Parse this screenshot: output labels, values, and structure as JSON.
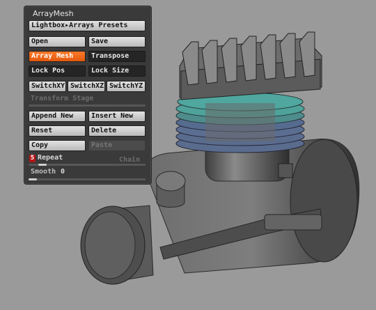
{
  "panel": {
    "title": "ArrayMesh",
    "lightbox_label": "Lightbox▸Arrays Presets",
    "open_label": "Open",
    "save_label": "Save",
    "array_mesh_label": "Array Mesh",
    "transpose_label": "Transpose",
    "lock_pos_label": "Lock Pos",
    "lock_size_label": "Lock Size",
    "switch_xy_label": "SwitchXY",
    "switch_xz_label": "SwitchXZ",
    "switch_yz_label": "SwitchYZ",
    "transform_stage_label": "Transform Stage",
    "append_new_label": "Append New",
    "insert_new_label": "Insert New",
    "reset_label": "Reset",
    "delete_label": "Delete",
    "copy_label": "Copy",
    "paste_label": "Paste",
    "repeat_value": "5",
    "repeat_label": "Repeat",
    "chain_label": "Chain",
    "smooth_label": "Smooth",
    "smooth_value": "0"
  },
  "colors": {
    "accent": "#f06a1c",
    "background": "#9a9a9a",
    "panel": "#3a3a3a"
  }
}
